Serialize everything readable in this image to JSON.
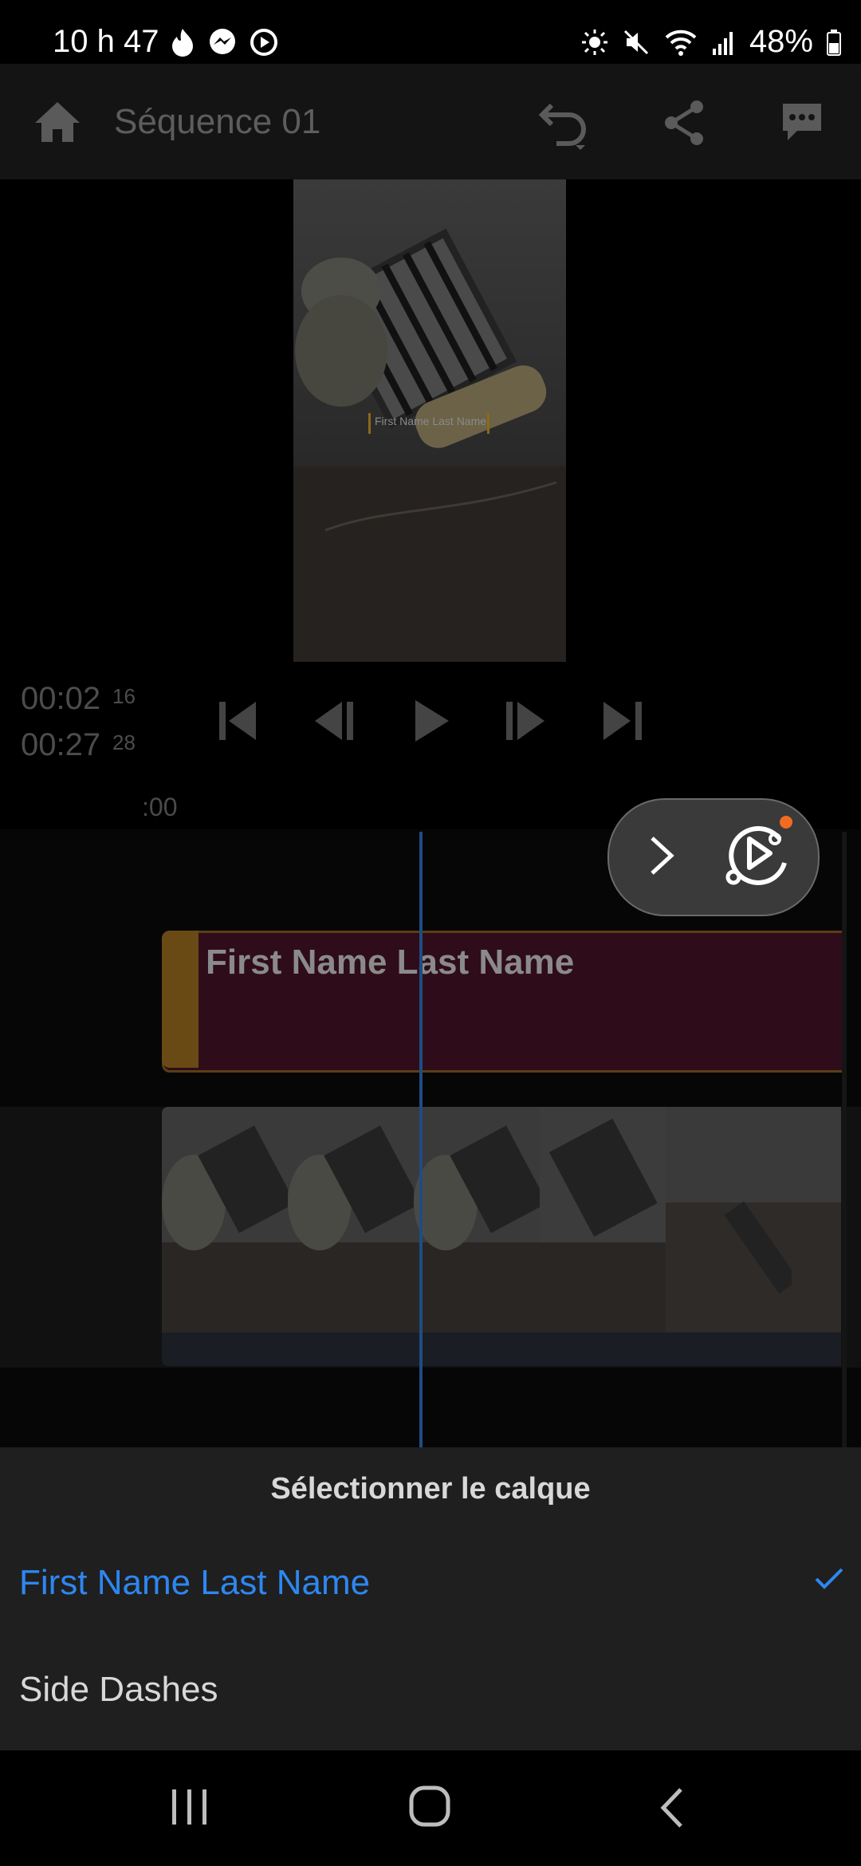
{
  "status_bar": {
    "time": "10 h 47",
    "battery": "48%",
    "left_icons": [
      "tinder-icon",
      "messenger-icon",
      "play-circle-icon"
    ],
    "right_icons": [
      "brightness-icon",
      "mute-icon",
      "wifi-icon",
      "signal-icon",
      "battery-icon"
    ]
  },
  "header": {
    "title": "Séquence  01",
    "home_icon": "home-icon",
    "undo_icon": "undo-icon",
    "share_icon": "share-icon",
    "feedback_icon": "comment-icon"
  },
  "preview": {
    "overlay_text": "First Name Last Name"
  },
  "playback": {
    "current_time": "00:02",
    "current_frames": "16",
    "total_time": "00:27",
    "total_frames": "28"
  },
  "timeline": {
    "ruler_start": ":00",
    "title_clip_label": "First Name Last Name"
  },
  "layer_sheet": {
    "title": "Sélectionner le calque",
    "items": [
      {
        "label": "First Name Last Name",
        "selected": true
      },
      {
        "label": "Side Dashes",
        "selected": false
      }
    ]
  },
  "colors": {
    "accent": "#2d87f0",
    "title_clip": "#2f0c1a",
    "clip_handle": "#6a4a14",
    "playhead": "#1d4d84",
    "notification_dot": "#f26b21"
  }
}
